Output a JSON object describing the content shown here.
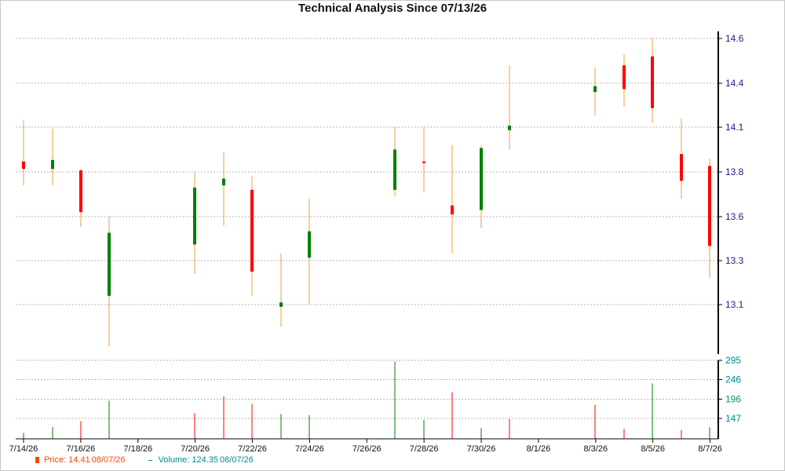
{
  "chart_data": {
    "type": "candlestick",
    "title": "Technical Analysis Since 07/13/26",
    "xlabel": "",
    "ylabel": "",
    "x_ticks": [
      "7/14/26",
      "7/16/26",
      "7/18/26",
      "7/20/26",
      "7/22/26",
      "7/24/26",
      "7/26/26",
      "7/28/26",
      "7/30/26",
      "8/1/26",
      "8/3/26",
      "8/5/26",
      "8/7/26"
    ],
    "price_ticks": [
      14.6,
      14.4,
      14.1,
      13.8,
      13.6,
      13.3,
      13.1
    ],
    "price_range": [
      12.85,
      14.6
    ],
    "volume_ticks": [
      295,
      246,
      196,
      147
    ],
    "volume_range": [
      95,
      295
    ],
    "grid": true,
    "legend_position": "bottom-left",
    "colors": {
      "up": "#008000",
      "down": "#ff0000",
      "wick": "#e8a040",
      "price_axis_text": "#1c1c8c",
      "volume_axis_text": "#008b8b",
      "grid": "#b4b4b4"
    },
    "candles": [
      {
        "date": "7/14/26",
        "open": 13.87,
        "high": 14.15,
        "low": 13.74,
        "close": 13.82
      },
      {
        "date": "7/15/26",
        "open": 13.82,
        "high": 14.09,
        "low": 13.74,
        "close": 13.88
      },
      {
        "date": "7/16/26",
        "open": 13.81,
        "high": 13.82,
        "low": 13.53,
        "close": 13.62
      },
      {
        "date": "7/17/26",
        "open": 13.14,
        "high": 13.6,
        "low": 12.91,
        "close": 13.49
      },
      {
        "date": "7/20/26",
        "open": 13.41,
        "high": 13.8,
        "low": 13.24,
        "close": 13.73
      },
      {
        "date": "7/21/26",
        "open": 13.74,
        "high": 13.93,
        "low": 13.54,
        "close": 13.77
      },
      {
        "date": "7/22/26",
        "open": 13.72,
        "high": 13.78,
        "low": 13.14,
        "close": 13.25
      },
      {
        "date": "7/23/26",
        "open": 13.09,
        "high": 13.35,
        "low": 13.0,
        "close": 13.11
      },
      {
        "date": "7/24/26",
        "open": 13.32,
        "high": 13.68,
        "low": 13.1,
        "close": 13.5
      },
      {
        "date": "7/27/26",
        "open": 13.72,
        "high": 14.1,
        "low": 13.69,
        "close": 13.95
      },
      {
        "date": "7/28/26",
        "open": 13.87,
        "high": 14.1,
        "low": 13.71,
        "close": 13.86
      },
      {
        "date": "7/29/26",
        "open": 13.65,
        "high": 13.98,
        "low": 13.35,
        "close": 13.61
      },
      {
        "date": "7/30/26",
        "open": 13.63,
        "high": 13.98,
        "low": 13.52,
        "close": 13.96
      },
      {
        "date": "7/31/26",
        "open": 14.08,
        "high": 14.48,
        "low": 13.95,
        "close": 14.11
      },
      {
        "date": "8/3/26",
        "open": 14.34,
        "high": 14.47,
        "low": 14.18,
        "close": 14.38
      },
      {
        "date": "8/4/26",
        "open": 14.48,
        "high": 14.53,
        "low": 14.24,
        "close": 14.36
      },
      {
        "date": "8/5/26",
        "open": 14.52,
        "high": 14.6,
        "low": 14.13,
        "close": 14.23
      },
      {
        "date": "8/6/26",
        "open": 13.92,
        "high": 14.16,
        "low": 13.68,
        "close": 13.76
      },
      {
        "date": "8/7/26",
        "open": 13.84,
        "high": 13.89,
        "low": 13.22,
        "close": 13.4
      }
    ],
    "volume": [
      {
        "date": "7/14/26",
        "value": 110,
        "direction": "up"
      },
      {
        "date": "7/15/26",
        "value": 125,
        "direction": "up"
      },
      {
        "date": "7/16/26",
        "value": 140,
        "direction": "down"
      },
      {
        "date": "7/17/26",
        "value": 192,
        "direction": "up"
      },
      {
        "date": "7/20/26",
        "value": 160,
        "direction": "down"
      },
      {
        "date": "7/21/26",
        "value": 203,
        "direction": "down"
      },
      {
        "date": "7/22/26",
        "value": 184,
        "direction": "down"
      },
      {
        "date": "7/23/26",
        "value": 158,
        "direction": "up"
      },
      {
        "date": "7/24/26",
        "value": 155,
        "direction": "up"
      },
      {
        "date": "7/27/26",
        "value": 292,
        "direction": "up"
      },
      {
        "date": "7/28/26",
        "value": 143,
        "direction": "up"
      },
      {
        "date": "7/29/26",
        "value": 214,
        "direction": "down"
      },
      {
        "date": "7/30/26",
        "value": 122,
        "direction": "up"
      },
      {
        "date": "7/31/26",
        "value": 145,
        "direction": "down"
      },
      {
        "date": "8/3/26",
        "value": 182,
        "direction": "down"
      },
      {
        "date": "8/4/26",
        "value": 120,
        "direction": "down"
      },
      {
        "date": "8/5/26",
        "value": 236,
        "direction": "up"
      },
      {
        "date": "8/6/26",
        "value": 117,
        "direction": "down"
      },
      {
        "date": "8/7/26",
        "value": 124.35,
        "direction": "up"
      }
    ],
    "legend": {
      "price_label": "Price: 14.41",
      "price_date": "08/07/26",
      "volume_label": "Volume: 124.35",
      "volume_date": "08/07/26"
    }
  }
}
